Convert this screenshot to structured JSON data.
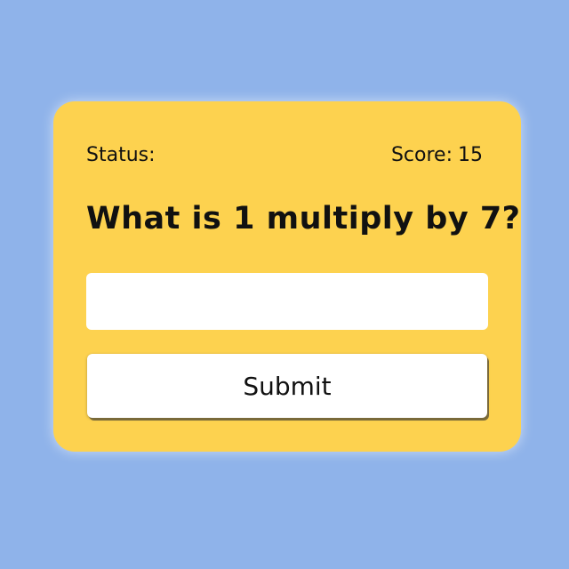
{
  "status": {
    "label": "Status:",
    "value": ""
  },
  "score": {
    "label": "Score:",
    "value": "15"
  },
  "question": {
    "text": "What is 1 multiply by 7?"
  },
  "answer": {
    "value": "",
    "placeholder": ""
  },
  "submit": {
    "label": "Submit"
  },
  "colors": {
    "background": "#8fb3ea",
    "card": "#fdd24f",
    "input": "#ffffff",
    "text": "#111111"
  }
}
